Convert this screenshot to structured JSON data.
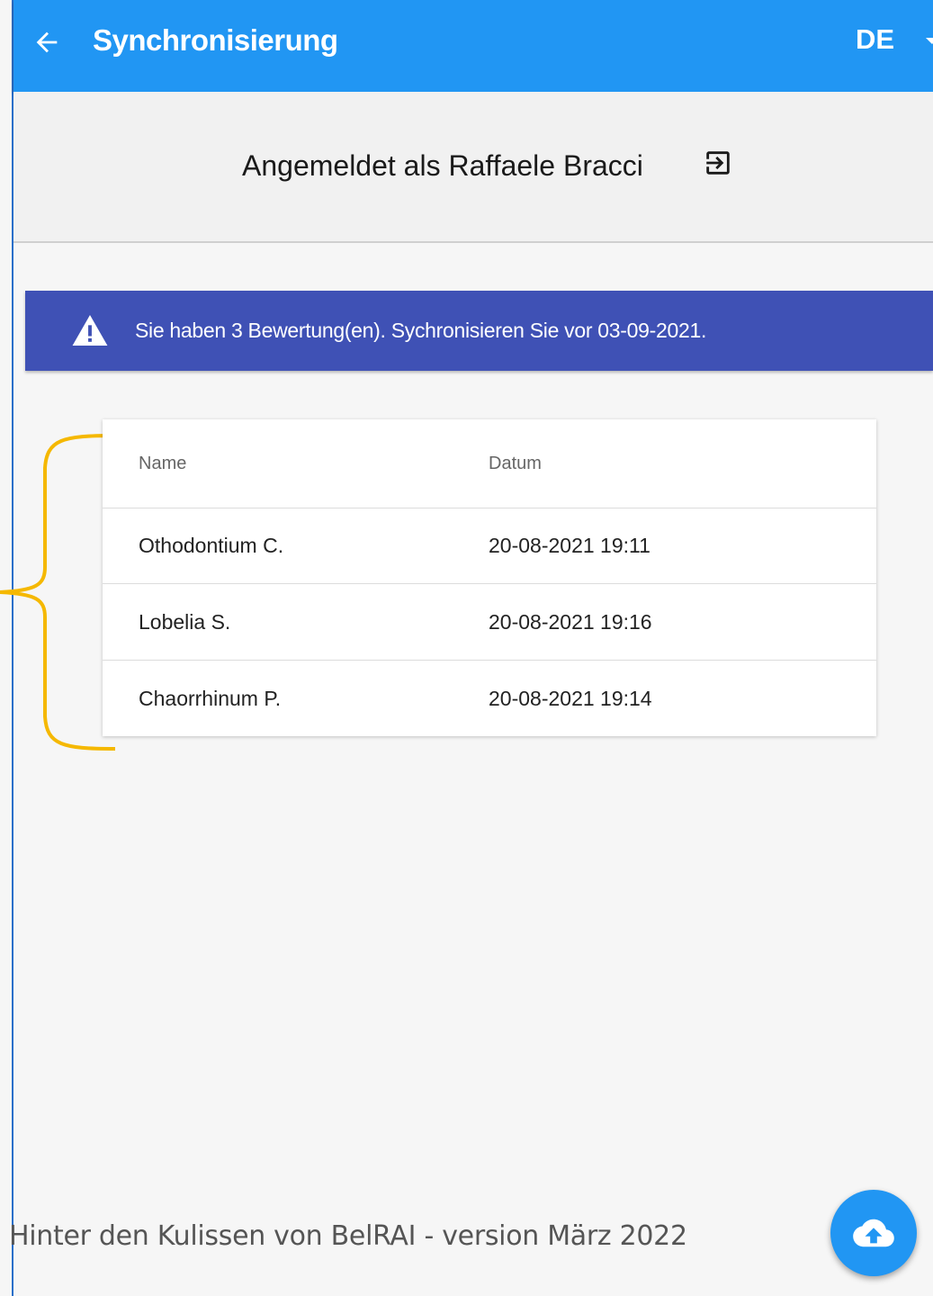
{
  "app_bar": {
    "title": "Synchronisierung",
    "language": "DE",
    "color": "#2196f3"
  },
  "login": {
    "text": "Angemeldet als Raffaele Bracci"
  },
  "warning": {
    "text": "Sie haben 3 Bewertung(en). Sychronisieren Sie vor 03-09-2021.",
    "color": "#3f51b5"
  },
  "table": {
    "columns": [
      "Name",
      "Datum"
    ],
    "rows": [
      {
        "name": "Othodontium C.",
        "date": "20-08-2021 19:11"
      },
      {
        "name": "Lobelia S.",
        "date": "20-08-2021 19:16"
      },
      {
        "name": "Chaorrhinum P.",
        "date": "20-08-2021 19:14"
      }
    ]
  },
  "footer": {
    "caption": "Hinter den Kulissen von BelRAI - version März 2022"
  },
  "icons": {
    "back": "arrow-back-icon",
    "language_dropdown": "chevron-down-icon",
    "logout": "logout-icon",
    "warning": "warning-icon",
    "upload": "cloud-upload-icon"
  },
  "annotation_color": "#f5b800"
}
